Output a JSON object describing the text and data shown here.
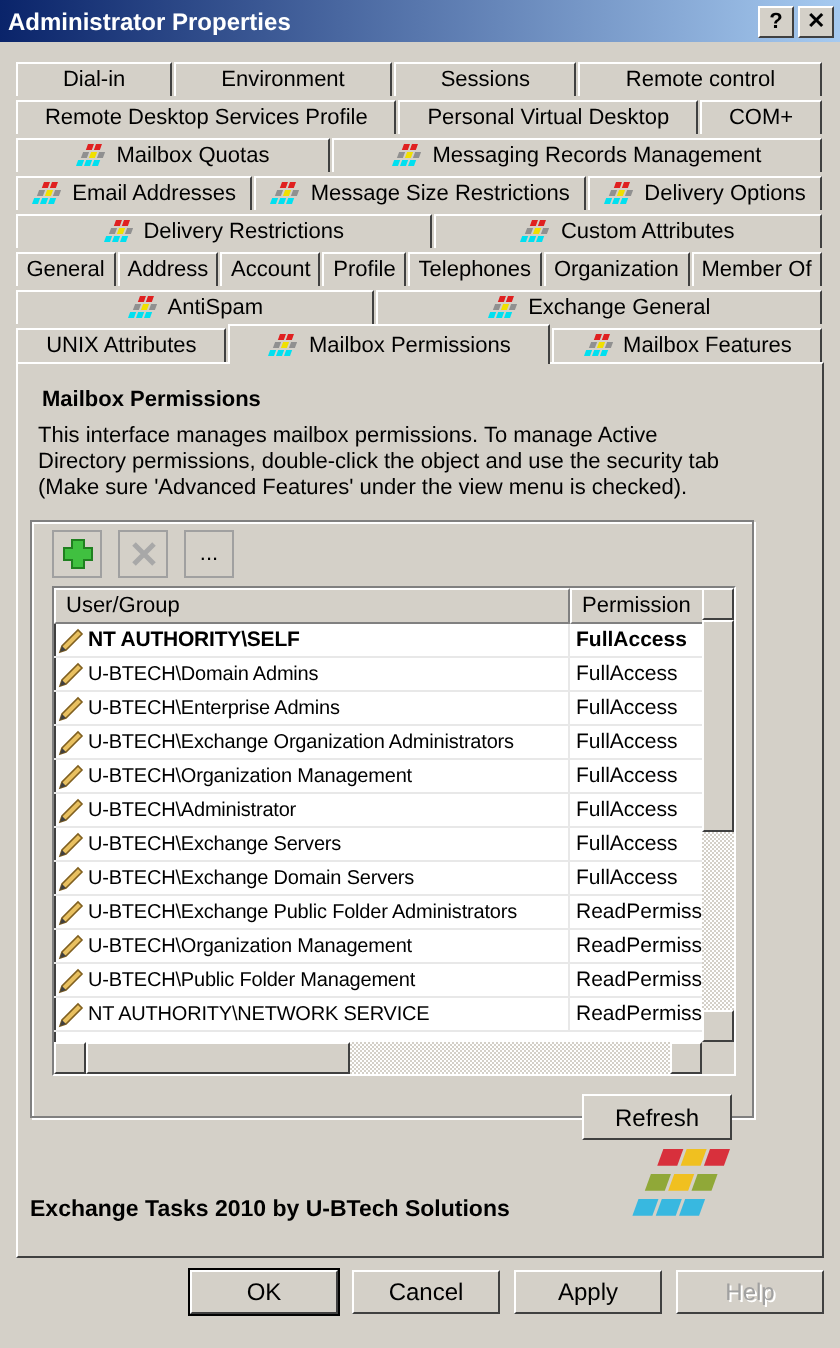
{
  "window": {
    "title": "Administrator Properties",
    "help_button": "?",
    "close_button": "✕"
  },
  "tab_rows": [
    [
      {
        "label": "Dial-in",
        "kind": "plain",
        "selected": false
      },
      {
        "label": "Environment",
        "kind": "plain",
        "selected": false
      },
      {
        "label": "Sessions",
        "kind": "plain",
        "selected": false
      },
      {
        "label": "Remote control",
        "kind": "plain",
        "selected": false
      }
    ],
    [
      {
        "label": "Remote Desktop Services Profile",
        "kind": "plain",
        "selected": false
      },
      {
        "label": "Personal Virtual Desktop",
        "kind": "plain",
        "selected": false
      },
      {
        "label": "COM+",
        "kind": "plain",
        "selected": false
      }
    ],
    [
      {
        "label": "Mailbox Quotas",
        "kind": "exchange",
        "selected": false
      },
      {
        "label": "Messaging Records Management",
        "kind": "exchange",
        "selected": false
      }
    ],
    [
      {
        "label": "Email Addresses",
        "kind": "exchange",
        "selected": false
      },
      {
        "label": "Message Size Restrictions",
        "kind": "exchange",
        "selected": false
      },
      {
        "label": "Delivery Options",
        "kind": "exchange",
        "selected": false
      }
    ],
    [
      {
        "label": "Delivery Restrictions",
        "kind": "exchange",
        "selected": false
      },
      {
        "label": "Custom Attributes",
        "kind": "exchange",
        "selected": false
      }
    ],
    [
      {
        "label": "General",
        "kind": "plain",
        "selected": false
      },
      {
        "label": "Address",
        "kind": "plain",
        "selected": false
      },
      {
        "label": "Account",
        "kind": "plain",
        "selected": false
      },
      {
        "label": "Profile",
        "kind": "plain",
        "selected": false
      },
      {
        "label": "Telephones",
        "kind": "plain",
        "selected": false
      },
      {
        "label": "Organization",
        "kind": "plain",
        "selected": false
      },
      {
        "label": "Member Of",
        "kind": "plain",
        "selected": false
      }
    ],
    [
      {
        "label": "AntiSpam",
        "kind": "exchange",
        "selected": false
      },
      {
        "label": "Exchange General",
        "kind": "exchange",
        "selected": false
      }
    ],
    [
      {
        "label": "UNIX Attributes",
        "kind": "plain",
        "selected": false
      },
      {
        "label": "Mailbox Permissions",
        "kind": "exchange",
        "selected": true
      },
      {
        "label": "Mailbox Features",
        "kind": "exchange",
        "selected": false
      }
    ]
  ],
  "panel": {
    "heading": "Mailbox Permissions",
    "description": "This interface manages mailbox permissions. To manage Active Directory permissions, double-click the object and use the security tab (Make sure 'Advanced Features' under the view menu is checked).",
    "toolbar": [
      {
        "kind": "add",
        "disabled": false
      },
      {
        "kind": "remove",
        "disabled": true
      },
      {
        "kind": "more",
        "label": "...",
        "disabled": false
      }
    ],
    "table": {
      "columns": [
        "User/Group",
        "Permission"
      ],
      "rows": [
        {
          "user": "NT AUTHORITY\\SELF",
          "permission": "FullAccess",
          "bold": true
        },
        {
          "user": "U-BTECH\\Domain Admins",
          "permission": "FullAccess",
          "bold": false
        },
        {
          "user": "U-BTECH\\Enterprise Admins",
          "permission": "FullAccess",
          "bold": false
        },
        {
          "user": "U-BTECH\\Exchange Organization Administrators",
          "permission": "FullAccess",
          "bold": false
        },
        {
          "user": "U-BTECH\\Organization Management",
          "permission": "FullAccess",
          "bold": false
        },
        {
          "user": "U-BTECH\\Administrator",
          "permission": "FullAccess",
          "bold": false
        },
        {
          "user": "U-BTECH\\Exchange Servers",
          "permission": "FullAccess",
          "bold": false
        },
        {
          "user": "U-BTECH\\Exchange Domain Servers",
          "permission": "FullAccess",
          "bold": false
        },
        {
          "user": "U-BTECH\\Exchange Public Folder Administrators",
          "permission": "ReadPermiss",
          "bold": false
        },
        {
          "user": "U-BTECH\\Organization Management",
          "permission": "ReadPermiss",
          "bold": false
        },
        {
          "user": "U-BTECH\\Public Folder Management",
          "permission": "ReadPermiss",
          "bold": false
        },
        {
          "user": "NT AUTHORITY\\NETWORK SERVICE",
          "permission": "ReadPermiss",
          "bold": false
        }
      ]
    },
    "refresh_button": "Refresh",
    "footer": "Exchange Tasks 2010 by U-BTech Solutions"
  },
  "buttons": [
    {
      "label": "OK",
      "default": true,
      "disabled": false
    },
    {
      "label": "Cancel",
      "default": false,
      "disabled": false
    },
    {
      "label": "Apply",
      "default": false,
      "disabled": false
    },
    {
      "label": "Help",
      "default": false,
      "disabled": true
    }
  ]
}
